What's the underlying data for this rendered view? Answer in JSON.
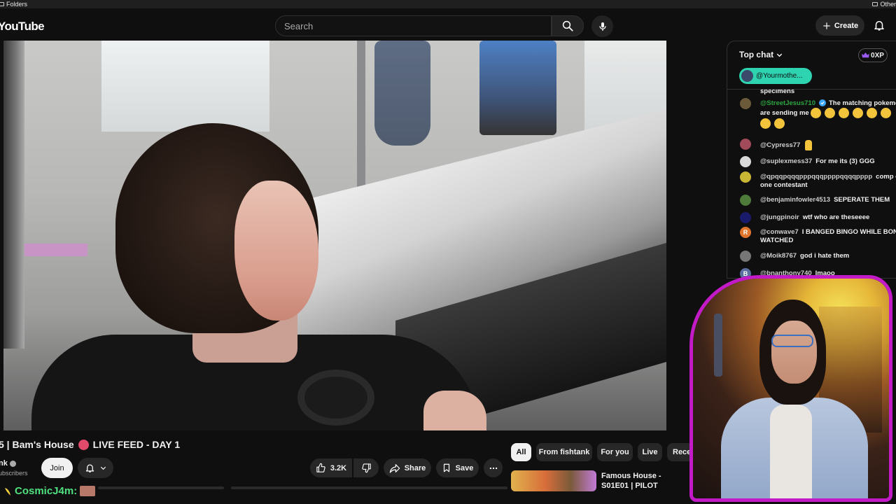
{
  "browser": {
    "bookmarks_left": "Folders",
    "bookmarks_right": "Other"
  },
  "masthead": {
    "logo_text": "YouTube",
    "search_placeholder": "Search",
    "create_label": "Create"
  },
  "video": {
    "title": "5 | Bam's House",
    "title_suffix": "LIVE FEED - DAY 1",
    "channel": "nk",
    "subscribers": "ubscribers",
    "join_label": "Join",
    "likes": "3.2K",
    "share_label": "Share",
    "save_label": "Save"
  },
  "stream_overlay": {
    "chat_user": "CosmicJ4m:"
  },
  "chips": [
    "All",
    "From fishtank",
    "For you",
    "Live",
    "Rece"
  ],
  "recommendation": {
    "title": "Famous House - S01E01 | PILOT"
  },
  "chat": {
    "mode_label": "Top chat",
    "xp_label": "0XP",
    "pinned_user": "@Yourmothe...",
    "top_cut_text": "specimens",
    "messages": [
      {
        "author": "@StreetJesus710",
        "text": "The matching pokemon are sending me",
        "avatar_color": "#6b5a3a",
        "member": true,
        "laughs": 8
      },
      {
        "author": "@Cypress77",
        "text": "",
        "avatar_color": "#a04a5a",
        "member": false,
        "peace": true
      },
      {
        "author": "@suplexmess37",
        "text": "For me its (3) GGG",
        "avatar_color": "#d9d9d9",
        "member": false
      },
      {
        "author": "@qpqqpqqqpppqqqppppqqqqpppp",
        "text": "comp of one contestant",
        "avatar_color": "#c9b634",
        "member": false
      },
      {
        "author": "@benjaminfowler4513",
        "text": "SEPERATE THEM",
        "avatar_color": "#4e7a3a",
        "member": false
      },
      {
        "author": "@jungpinoir",
        "text": "wtf who are theseeee",
        "avatar_color": "#1a1a6a",
        "member": false
      },
      {
        "author": "@conwave7",
        "text": "I BANGED BINGO WHILE BONGO WATCHED",
        "avatar_color": "#e0742a",
        "member": false,
        "avatar_letter": "R"
      },
      {
        "author": "@Moik8767",
        "text": "god i hate them",
        "avatar_color": "#777777",
        "member": false
      },
      {
        "author": "@bnanthony740",
        "text": "lmaoo",
        "avatar_color": "#5a6fa0",
        "member": false,
        "avatar_letter": "B"
      }
    ]
  },
  "colors": {
    "background": "#0f0f0f",
    "webcam_border": "#c21ac7",
    "pinned_chip": "#2ed3b0",
    "member_name": "#2ba640",
    "overlay_user": "#4fe07f"
  }
}
